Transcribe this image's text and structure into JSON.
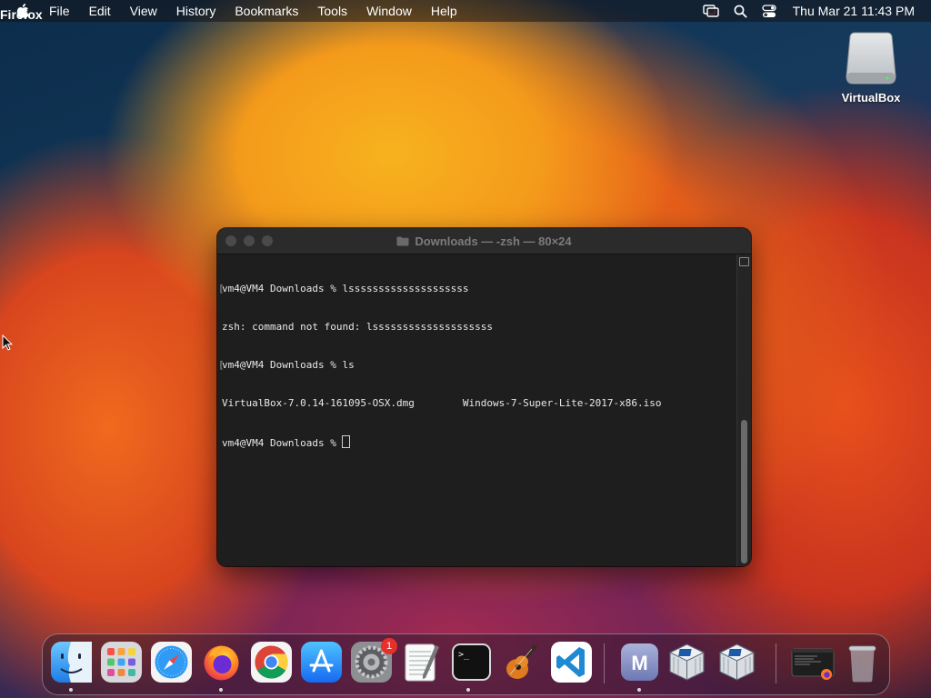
{
  "menubar": {
    "app_name": "Firefox",
    "items": [
      "File",
      "Edit",
      "View",
      "History",
      "Bookmarks",
      "Tools",
      "Window",
      "Help"
    ],
    "clock": "Thu Mar 21  11:43 PM"
  },
  "desktop": {
    "icons": [
      {
        "label": "VirtualBox",
        "icon": "external-disk-icon"
      }
    ]
  },
  "terminal": {
    "title": "Downloads — -zsh — 80×24",
    "lines": [
      "vm4@VM4 Downloads % lssssssssssssssssssss",
      "zsh: command not found: lssssssssssssssssssss",
      "vm4@VM4 Downloads % ls",
      "VirtualBox-7.0.14-161095-OSX.dmg        Windows-7-Super-Lite-2017-x86.iso",
      "vm4@VM4 Downloads % "
    ]
  },
  "dock": {
    "apps": [
      {
        "name": "Finder",
        "icon": "finder-icon",
        "running": true
      },
      {
        "name": "Launchpad",
        "icon": "launchpad-icon",
        "running": false
      },
      {
        "name": "Safari",
        "icon": "safari-icon",
        "running": false
      },
      {
        "name": "Firefox",
        "icon": "firefox-icon",
        "running": true
      },
      {
        "name": "Google Chrome",
        "icon": "chrome-icon",
        "running": false
      },
      {
        "name": "App Store",
        "icon": "app-store-icon",
        "running": false
      },
      {
        "name": "System Preferences",
        "icon": "system-preferences-icon",
        "running": false,
        "badge": "1"
      },
      {
        "name": "TextEdit",
        "icon": "textedit-icon",
        "running": false
      },
      {
        "name": "Terminal",
        "icon": "terminal-icon",
        "running": true
      },
      {
        "name": "GarageBand",
        "icon": "garageband-icon",
        "running": false
      },
      {
        "name": "Visual Studio Code",
        "icon": "vscode-icon",
        "running": false
      },
      {
        "name": "Mail",
        "icon": "mail-m-icon",
        "running": true,
        "letter": "M"
      },
      {
        "name": "VirtualBox",
        "icon": "virtualbox-icon",
        "running": false
      },
      {
        "name": "VirtualBox",
        "icon": "virtualbox-icon",
        "running": false
      },
      {
        "name": "Terminal window",
        "icon": "terminal-window-icon",
        "running": false
      },
      {
        "name": "Trash",
        "icon": "trash-icon",
        "running": false
      }
    ]
  }
}
